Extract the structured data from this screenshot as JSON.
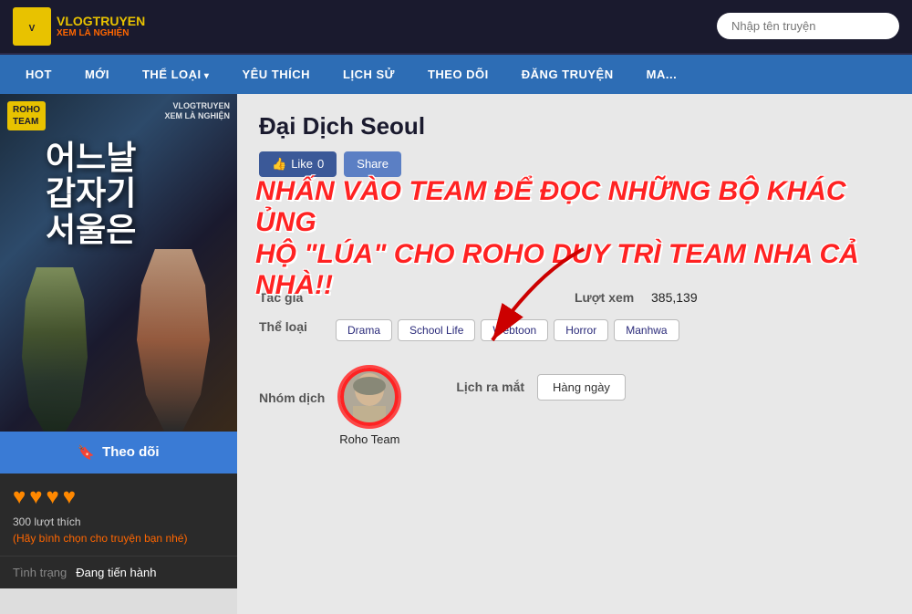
{
  "site": {
    "logo_main": "VLOGTRUYEN",
    "logo_sub": "XEM LÀ NGHIỆN",
    "search_placeholder": "Nhập tên truyện"
  },
  "nav": {
    "items": [
      {
        "label": "HOT",
        "dropdown": false
      },
      {
        "label": "MỚI",
        "dropdown": false
      },
      {
        "label": "THỂ LOẠI",
        "dropdown": true
      },
      {
        "label": "YÊU THÍCH",
        "dropdown": false
      },
      {
        "label": "LỊCH SỬ",
        "dropdown": false
      },
      {
        "label": "THEO DÕI",
        "dropdown": false
      },
      {
        "label": "ĐĂNG TRUYỆN",
        "dropdown": false
      },
      {
        "label": "MA...",
        "dropdown": false
      }
    ]
  },
  "manga": {
    "title": "Đại Dịch Seoul",
    "cover_title_kr": "어느날\n갑자기\n서울은",
    "team_label": "ROHO\nTEAM",
    "watermark_line1": "VLOGTRUYEN",
    "watermark_line2": "XEM LÀ NGHIỆN",
    "like_count": "0",
    "like_label": "Like",
    "share_label": "Share",
    "overlay_line1": "NHẤN VÀO TEAM ĐỂ ĐỌC NHỮNG BỘ KHÁC ỦNG",
    "overlay_line2": "HỘ \"LÚA\" CHO ROHO DUY TRÌ TEAM NHA CẢ NHÀ!!",
    "author_label": "Tác giả",
    "author_value": "",
    "genre_label": "Thể loại",
    "genres": [
      "Drama",
      "School Life",
      "Webtoon",
      "Horror",
      "Manhwa"
    ],
    "translator_label": "Nhóm dịch",
    "translator_name": "Roho Team",
    "views_label": "Lượt xem",
    "views_value": "385,139",
    "schedule_label": "Lịch ra mắt",
    "schedule_value": "Hàng ngày",
    "follow_label": "Theo dõi",
    "hearts": [
      "♥",
      "♥",
      "♥",
      "♥"
    ],
    "likes_text": "300 lượt thích",
    "vote_prompt": "(Hãy bình chọn cho truyện bạn nhé)",
    "status_label": "Tình trạng",
    "status_value": "Đang tiến hành"
  }
}
